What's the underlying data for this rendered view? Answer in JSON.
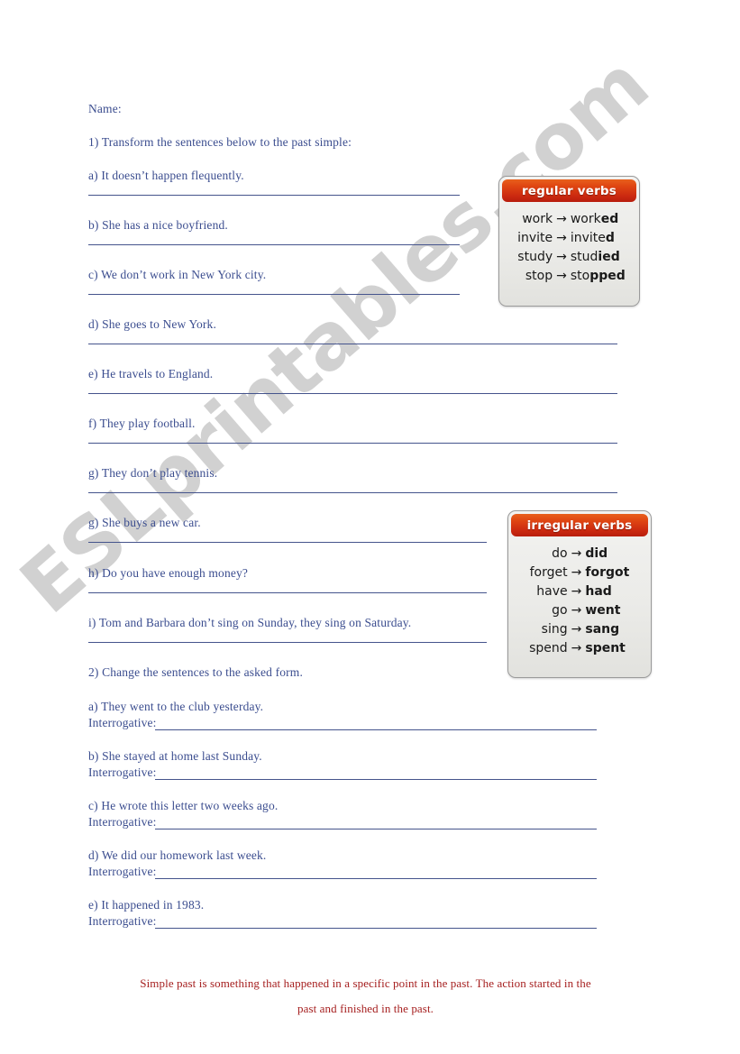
{
  "watermark": {
    "text": "ESLprintables.com"
  },
  "header": {
    "name_label": "Name:"
  },
  "section1": {
    "instruction": "1) Transform the sentences below to the past simple:",
    "items": [
      {
        "label": "a) It doesn’t happen flequently."
      },
      {
        "label": "b) She has a nice boyfriend."
      },
      {
        "label": "c) We don’t work in New York city."
      },
      {
        "label": "d) She goes to New York."
      },
      {
        "label": "e) He travels to England."
      },
      {
        "label": "f) They play football."
      },
      {
        "label": "g) They don’t play tennis."
      },
      {
        "label": "g) She buys a new car."
      },
      {
        "label": "h) Do you have enough money?"
      },
      {
        "label": "i) Tom and Barbara don’t sing on Sunday, they sing on Saturday."
      }
    ]
  },
  "section2": {
    "instruction": "2) Change the sentences to the asked form.",
    "answer_label": "Interrogative:",
    "items": [
      {
        "label": "a) They went to the club yesterday."
      },
      {
        "label": "b) She stayed at home last Sunday."
      },
      {
        "label": "c) He wrote this letter two weeks ago."
      },
      {
        "label": "d) We did our homework last week."
      },
      {
        "label": "e) It happened in 1983."
      }
    ]
  },
  "regular_box": {
    "title": "regular verbs",
    "arrow": "→",
    "rows": [
      {
        "base": "work",
        "past_stem": "work",
        "past_suffix": "ed"
      },
      {
        "base": "invite",
        "past_stem": "invite",
        "past_suffix": "d"
      },
      {
        "base": "study",
        "past_stem": "stud",
        "past_suffix": "ied"
      },
      {
        "base": "stop",
        "past_stem": "sto",
        "past_suffix": "pped"
      }
    ]
  },
  "irregular_box": {
    "title": "irregular verbs",
    "arrow": "→",
    "rows": [
      {
        "base": "do",
        "past": "did"
      },
      {
        "base": "forget",
        "past": "forgot"
      },
      {
        "base": "have",
        "past": "had"
      },
      {
        "base": "go",
        "past": "went"
      },
      {
        "base": "sing",
        "past": "sang"
      },
      {
        "base": "spend",
        "past": "spent"
      }
    ]
  },
  "footer": {
    "line1": "Simple past is something that happened in a specific point in the past. The action started in the",
    "line2": "past and finished in the past."
  },
  "colors": {
    "text_blue": "#3b4d8f",
    "rule_blue": "#45548c",
    "footer_red": "#a62020",
    "header_red": "#d3380f",
    "watermark_gray": "#c9c9c9"
  }
}
